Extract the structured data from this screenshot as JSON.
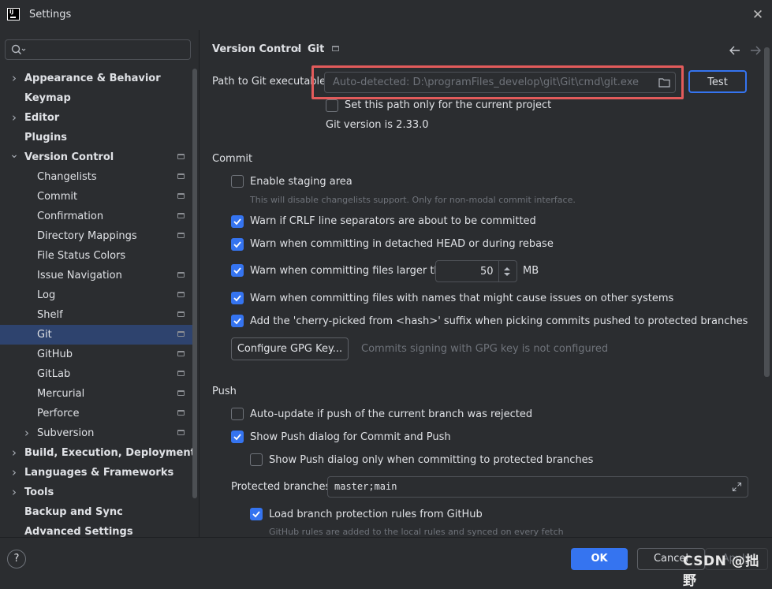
{
  "window": {
    "title": "Settings"
  },
  "sidebar": {
    "items": [
      {
        "label": "Appearance & Behavior",
        "level": 0,
        "bold": true,
        "arrow": "right",
        "pin": false,
        "selected": false
      },
      {
        "label": "Keymap",
        "level": 0,
        "bold": true,
        "arrow": "",
        "pin": false,
        "selected": false
      },
      {
        "label": "Editor",
        "level": 0,
        "bold": true,
        "arrow": "right",
        "pin": false,
        "selected": false
      },
      {
        "label": "Plugins",
        "level": 0,
        "bold": true,
        "arrow": "",
        "pin": false,
        "selected": false
      },
      {
        "label": "Version Control",
        "level": 0,
        "bold": true,
        "arrow": "down",
        "pin": true,
        "selected": false
      },
      {
        "label": "Changelists",
        "level": 1,
        "bold": false,
        "arrow": "",
        "pin": true,
        "selected": false
      },
      {
        "label": "Commit",
        "level": 1,
        "bold": false,
        "arrow": "",
        "pin": true,
        "selected": false
      },
      {
        "label": "Confirmation",
        "level": 1,
        "bold": false,
        "arrow": "",
        "pin": true,
        "selected": false
      },
      {
        "label": "Directory Mappings",
        "level": 1,
        "bold": false,
        "arrow": "",
        "pin": true,
        "selected": false
      },
      {
        "label": "File Status Colors",
        "level": 1,
        "bold": false,
        "arrow": "",
        "pin": false,
        "selected": false
      },
      {
        "label": "Issue Navigation",
        "level": 1,
        "bold": false,
        "arrow": "",
        "pin": true,
        "selected": false
      },
      {
        "label": "Log",
        "level": 1,
        "bold": false,
        "arrow": "",
        "pin": true,
        "selected": false
      },
      {
        "label": "Shelf",
        "level": 1,
        "bold": false,
        "arrow": "",
        "pin": true,
        "selected": false
      },
      {
        "label": "Git",
        "level": 1,
        "bold": false,
        "arrow": "",
        "pin": true,
        "selected": true
      },
      {
        "label": "GitHub",
        "level": 1,
        "bold": false,
        "arrow": "",
        "pin": true,
        "selected": false
      },
      {
        "label": "GitLab",
        "level": 1,
        "bold": false,
        "arrow": "",
        "pin": true,
        "selected": false
      },
      {
        "label": "Mercurial",
        "level": 1,
        "bold": false,
        "arrow": "",
        "pin": true,
        "selected": false
      },
      {
        "label": "Perforce",
        "level": 1,
        "bold": false,
        "arrow": "",
        "pin": true,
        "selected": false
      },
      {
        "label": "Subversion",
        "level": 1,
        "bold": false,
        "arrow": "right",
        "pin": true,
        "selected": false
      },
      {
        "label": "Build, Execution, Deployment",
        "level": 0,
        "bold": true,
        "arrow": "right",
        "pin": false,
        "selected": false
      },
      {
        "label": "Languages & Frameworks",
        "level": 0,
        "bold": true,
        "arrow": "right",
        "pin": false,
        "selected": false
      },
      {
        "label": "Tools",
        "level": 0,
        "bold": true,
        "arrow": "right",
        "pin": false,
        "selected": false
      },
      {
        "label": "Backup and Sync",
        "level": 0,
        "bold": true,
        "arrow": "",
        "pin": false,
        "selected": false
      },
      {
        "label": "Advanced Settings",
        "level": 0,
        "bold": true,
        "arrow": "",
        "pin": false,
        "selected": false
      }
    ]
  },
  "breadcrumb": {
    "parent": "Version Control",
    "separator": "›",
    "current": "Git"
  },
  "git": {
    "path_label": "Path to Git executable:",
    "path_value": "Auto-detected: D:\\programFiles_develop\\git\\Git\\cmd\\git.exe",
    "test_label": "Test",
    "project_only_label": "Set this path only for the current project",
    "version_text": "Git version is 2.33.0"
  },
  "commit": {
    "section_title": "Commit",
    "staging_label": "Enable staging area",
    "staging_hint": "This will disable changelists support. Only for non-modal commit interface.",
    "crlf_label": "Warn if CRLF line separators are about to be committed",
    "detached_label": "Warn when committing in detached HEAD or during rebase",
    "large_label": "Warn when committing files larger than",
    "large_value": "50",
    "large_unit": "MB",
    "names_label": "Warn when committing files with names that might cause issues on other systems",
    "cherry_label": "Add the 'cherry-picked from <hash>' suffix when picking commits pushed to protected branches",
    "gpg_button": "Configure GPG Key...",
    "gpg_status": "Commits signing with GPG key is not configured"
  },
  "push": {
    "section_title": "Push",
    "autoupdate_label": "Auto-update if push of the current branch was rejected",
    "dialog_label": "Show Push dialog for Commit and Push",
    "dialog_protected_label": "Show Push dialog only when committing to protected branches",
    "protected_label": "Protected branches:",
    "protected_value": "master;main",
    "load_rules_label": "Load branch protection rules from GitHub",
    "load_rules_hint": "GitHub rules are added to the local rules and synced on every fetch"
  },
  "footer": {
    "help": "?",
    "ok": "OK",
    "cancel": "Cancel",
    "apply": "Apply",
    "watermark": "CSDN @拙野"
  },
  "colors": {
    "accent": "#3574f0",
    "selection": "#2e436e",
    "highlight_box": "#e35b5b",
    "background": "#2b2d30"
  }
}
